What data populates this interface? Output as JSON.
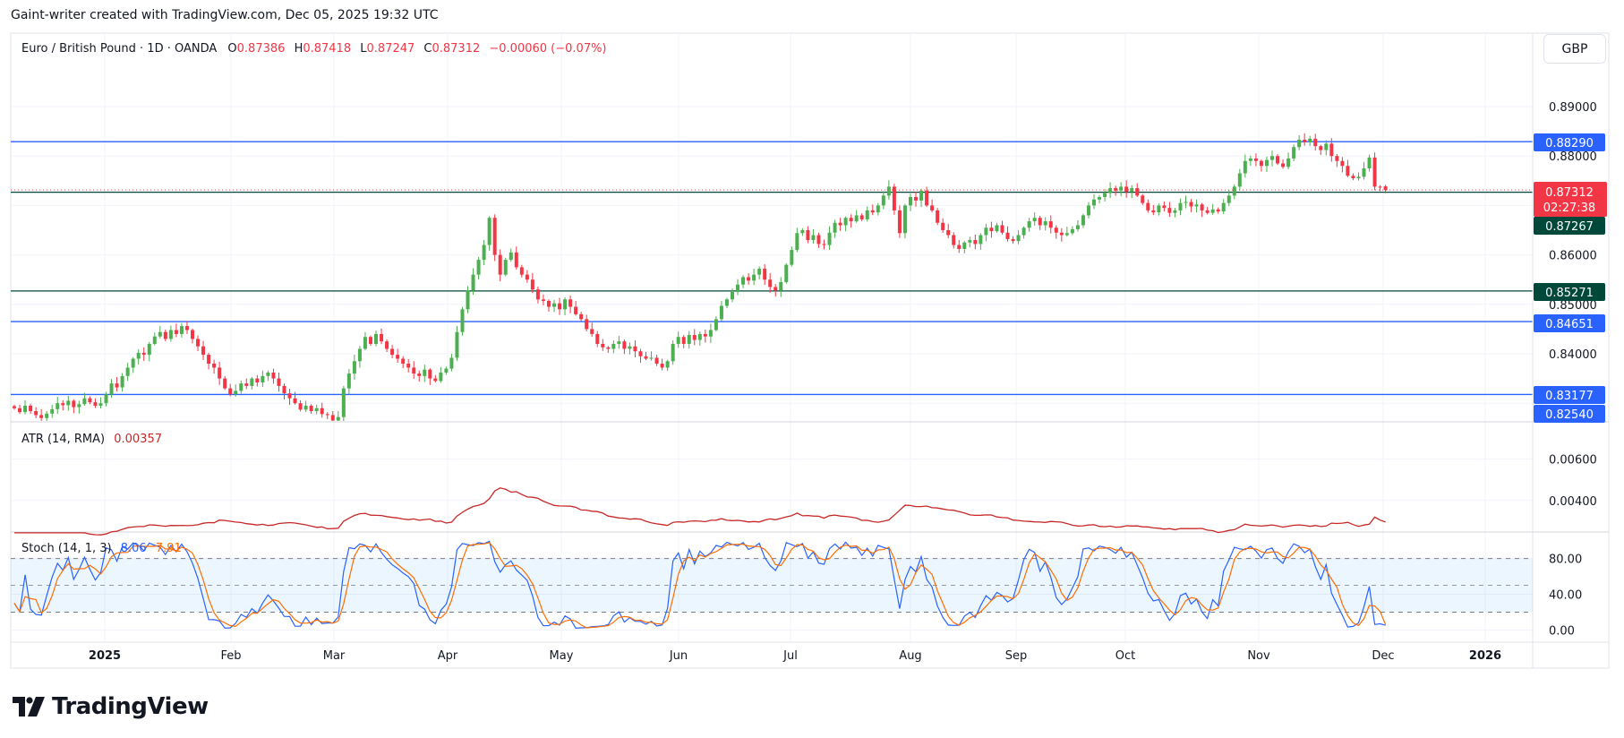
{
  "credit": "Gaint-writer created with TradingView.com, Dec 05, 2025 19:32 UTC",
  "legend": {
    "symbol": "Euro / British Pound · 1D · OANDA",
    "o_label": "O",
    "o": "0.87386",
    "h_label": "H",
    "h": "0.87418",
    "l_label": "L",
    "l": "0.87247",
    "c_label": "C",
    "c": "0.87312",
    "change": "−0.00060 (−0.07%)"
  },
  "currency_button": "GBP",
  "price_axis": {
    "ticks": [
      "0.89000",
      "0.88000",
      "0.86000",
      "0.85000",
      "0.84000"
    ],
    "tick_values": [
      0.89,
      0.88,
      0.86,
      0.85,
      0.84
    ],
    "grid_values": [
      0.89,
      0.88,
      0.87,
      0.86,
      0.85,
      0.84,
      0.83
    ]
  },
  "horizontal_lines": [
    {
      "price": 0.8829,
      "label": "0.88290",
      "color": "#2962ff"
    },
    {
      "price": 0.84651,
      "label": "0.84651",
      "color": "#2962ff"
    },
    {
      "price": 0.83177,
      "label": "0.83177",
      "color": "#2962ff"
    },
    {
      "price": 0.8254,
      "label": "0.82540",
      "color": "#2962ff"
    },
    {
      "price": 0.87267,
      "label": "0.87267",
      "color": "#00483a"
    },
    {
      "price": 0.85271,
      "label": "0.85271",
      "color": "#00483a"
    }
  ],
  "current_price": {
    "price": 0.87312,
    "label": "0.87312",
    "countdown": "02:27:38",
    "color": "#f23645"
  },
  "time_axis": [
    "2025",
    "Feb",
    "Mar",
    "Apr",
    "May",
    "Jun",
    "Jul",
    "Aug",
    "Sep",
    "Oct",
    "Nov",
    "Dec",
    "2026"
  ],
  "atr": {
    "title": "ATR (14, RMA)",
    "value": "0.00357",
    "color": "#c62828",
    "ticks": [
      "0.00600",
      "0.00400"
    ],
    "tick_values": [
      0.006,
      0.004
    ]
  },
  "stoch": {
    "title": "Stoch (14, 1, 3)",
    "k_value": "8.06",
    "d_value": "7.91",
    "k_color": "#2962ff",
    "d_color": "#ff6d00",
    "ticks": [
      "80.00",
      "40.00",
      "0.00"
    ],
    "tick_values": [
      80,
      40,
      0
    ],
    "bands": [
      80,
      50,
      20
    ]
  },
  "colors": {
    "up": "#4caf50",
    "down": "#f23645"
  },
  "brand": "TradingView",
  "chart_data": {
    "type": "candlestick",
    "symbol": "EURGBP",
    "interval": "1D",
    "ylim": [
      0.8254,
      0.895
    ],
    "last_bar": {
      "open": 0.87386,
      "high": 0.87418,
      "low": 0.87247,
      "close": 0.87312
    },
    "close": [
      0.829,
      0.8282,
      0.8295,
      0.8284,
      0.8276,
      0.827,
      0.8279,
      0.8288,
      0.83,
      0.8296,
      0.8305,
      0.8292,
      0.8298,
      0.831,
      0.8302,
      0.8295,
      0.83,
      0.8318,
      0.834,
      0.8332,
      0.8355,
      0.8372,
      0.839,
      0.8402,
      0.8398,
      0.842,
      0.8435,
      0.8444,
      0.843,
      0.8448,
      0.844,
      0.8456,
      0.8448,
      0.843,
      0.8415,
      0.8398,
      0.838,
      0.8372,
      0.835,
      0.833,
      0.8318,
      0.8325,
      0.834,
      0.8335,
      0.835,
      0.8342,
      0.8355,
      0.8362,
      0.835,
      0.8335,
      0.832,
      0.831,
      0.83,
      0.8287,
      0.8295,
      0.8284,
      0.829,
      0.8278,
      0.8276,
      0.8265,
      0.8272,
      0.833,
      0.836,
      0.8385,
      0.841,
      0.8434,
      0.842,
      0.844,
      0.8425,
      0.841,
      0.8398,
      0.839,
      0.838,
      0.8372,
      0.836,
      0.8355,
      0.8368,
      0.835,
      0.8345,
      0.8362,
      0.837,
      0.8392,
      0.8444,
      0.849,
      0.8528,
      0.856,
      0.859,
      0.862,
      0.8675,
      0.86,
      0.856,
      0.859,
      0.8605,
      0.8575,
      0.856,
      0.855,
      0.853,
      0.851,
      0.8507,
      0.8495,
      0.8502,
      0.849,
      0.851,
      0.8495,
      0.848,
      0.847,
      0.845,
      0.844,
      0.842,
      0.8413,
      0.841,
      0.842,
      0.8425,
      0.841,
      0.8415,
      0.8405,
      0.8395,
      0.839,
      0.8392,
      0.838,
      0.8372,
      0.8385,
      0.842,
      0.8434,
      0.842,
      0.8438,
      0.8428,
      0.844,
      0.8435,
      0.8448,
      0.847,
      0.8497,
      0.851,
      0.8525,
      0.854,
      0.8555,
      0.8548,
      0.856,
      0.8572,
      0.855,
      0.8535,
      0.8528,
      0.8545,
      0.858,
      0.861,
      0.8644,
      0.865,
      0.863,
      0.864,
      0.8622,
      0.862,
      0.8645,
      0.8665,
      0.866,
      0.8675,
      0.8668,
      0.868,
      0.8672,
      0.869,
      0.8686,
      0.87,
      0.872,
      0.8738,
      0.869,
      0.8644,
      0.87,
      0.8717,
      0.871,
      0.873,
      0.87,
      0.869,
      0.8665,
      0.865,
      0.864,
      0.862,
      0.8612,
      0.8625,
      0.863,
      0.8622,
      0.864,
      0.8655,
      0.8648,
      0.866,
      0.8645,
      0.8632,
      0.8628,
      0.864,
      0.8655,
      0.8668,
      0.8675,
      0.866,
      0.8668,
      0.8655,
      0.8645,
      0.864,
      0.8644,
      0.8652,
      0.866,
      0.868,
      0.87,
      0.8712,
      0.8717,
      0.8725,
      0.8735,
      0.873,
      0.8738,
      0.8728,
      0.8735,
      0.872,
      0.8705,
      0.869,
      0.8686,
      0.87,
      0.8695,
      0.8685,
      0.869,
      0.8705,
      0.8707,
      0.8698,
      0.8702,
      0.869,
      0.8685,
      0.8692,
      0.8688,
      0.8705,
      0.872,
      0.8738,
      0.8765,
      0.879,
      0.8795,
      0.879,
      0.878,
      0.8792,
      0.88,
      0.8785,
      0.8778,
      0.8795,
      0.8818,
      0.8833,
      0.8828,
      0.8835,
      0.882,
      0.8812,
      0.8825,
      0.88,
      0.879,
      0.878,
      0.876,
      0.8755,
      0.8758,
      0.8775,
      0.8797,
      0.8738,
      0.8737,
      0.87312
    ]
  }
}
